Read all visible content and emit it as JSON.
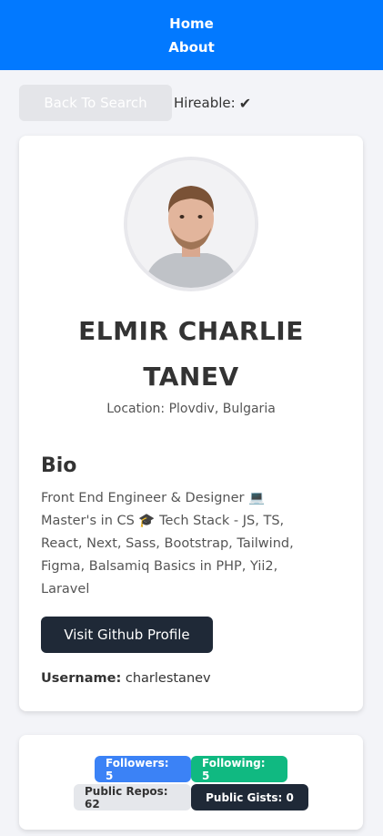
{
  "nav": {
    "home": "Home",
    "about": "About"
  },
  "topbar": {
    "back_label": "Back To Search",
    "hireable_label": "Hireable:",
    "hireable_icon": "✔"
  },
  "profile": {
    "name": "ELMIR CHARLIE TANEV",
    "location": "Location: Plovdiv, Bulgaria",
    "bio_title": "Bio",
    "bio": "Front End Engineer & Designer 💻 Master's in CS 🎓 Tech Stack - JS, TS, React, Next, Sass, Bootstrap, Tailwind, Figma, Balsamiq Basics in PHP, Yii2, Laravel",
    "visit_label": "Visit Github Profile",
    "username_label": "Username:",
    "username": "charlestanev"
  },
  "stats": {
    "followers": "Followers: 5",
    "following": "Following: 5",
    "public_repos": "Public Repos: 62",
    "public_gists": "Public Gists: 0"
  },
  "colors": {
    "nav": "#0279ff",
    "dark": "#1f2937",
    "blue": "#3b82f6",
    "green": "#10b981"
  }
}
